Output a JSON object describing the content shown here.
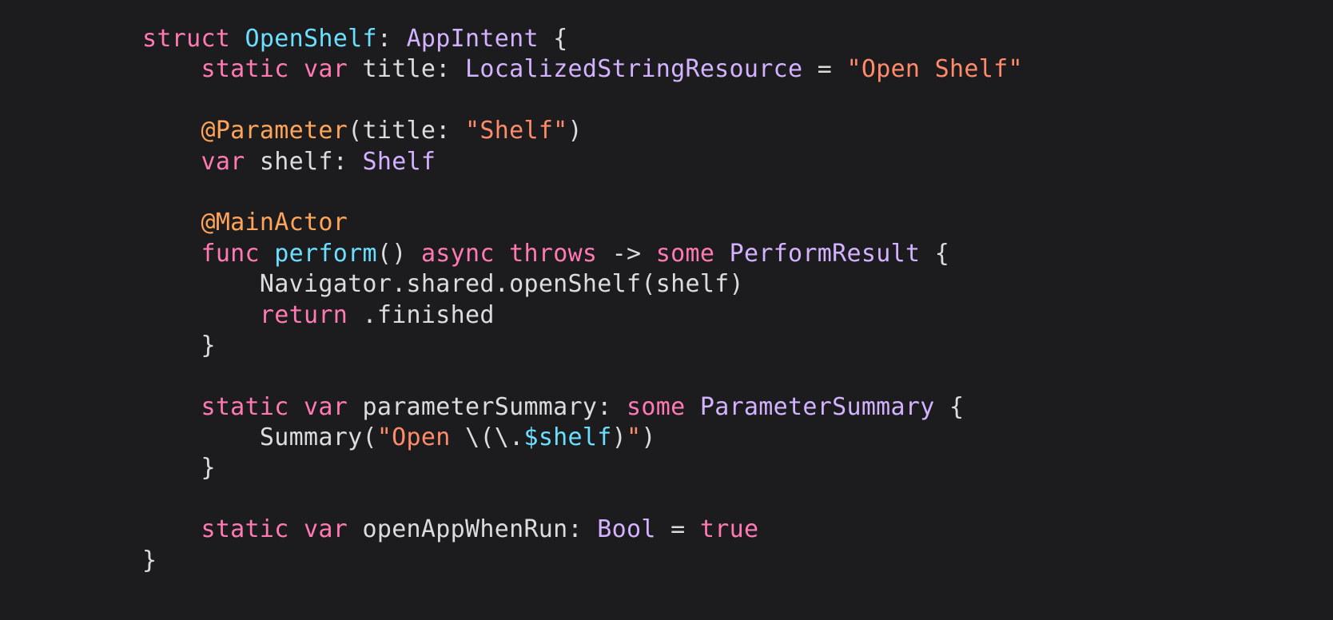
{
  "code": {
    "t": {
      "struct": "struct",
      "static": "static",
      "var": "var",
      "func": "func",
      "async": "async",
      "throws": "throws",
      "some": "some",
      "return": "return",
      "true": "true",
      "arrow": "->",
      "lbrace": "{",
      "rbrace": "}",
      "lparen": "(",
      "rparen": ")",
      "colon": ":",
      "eq": "=",
      "dot": ".",
      "comma": ","
    },
    "names": {
      "OpenShelf": "OpenShelf",
      "AppIntent": "AppIntent",
      "title": "title",
      "LocalizedStringResource": "LocalizedStringResource",
      "shelf": "shelf",
      "Shelf": "Shelf",
      "perform": "perform",
      "PerformResult": "PerformResult",
      "Navigator": "Navigator",
      "shared": "shared",
      "openShelf": "openShelf",
      "finished": "finished",
      "parameterSummary": "parameterSummary",
      "ParameterSummary": "ParameterSummary",
      "Summary": "Summary",
      "openAppWhenRun": "openAppWhenRun",
      "Bool": "Bool"
    },
    "attrs": {
      "Parameter": "@Parameter",
      "MainActor": "@MainActor"
    },
    "strings": {
      "openShelf": "\"Open Shelf\"",
      "shelf": "\"Shelf\"",
      "open_prefix": "\"Open ",
      "open_suffix": "\""
    },
    "interp": {
      "open": "\\(",
      "keypath": "\\.",
      "ref": "$shelf",
      "close": ")"
    }
  }
}
